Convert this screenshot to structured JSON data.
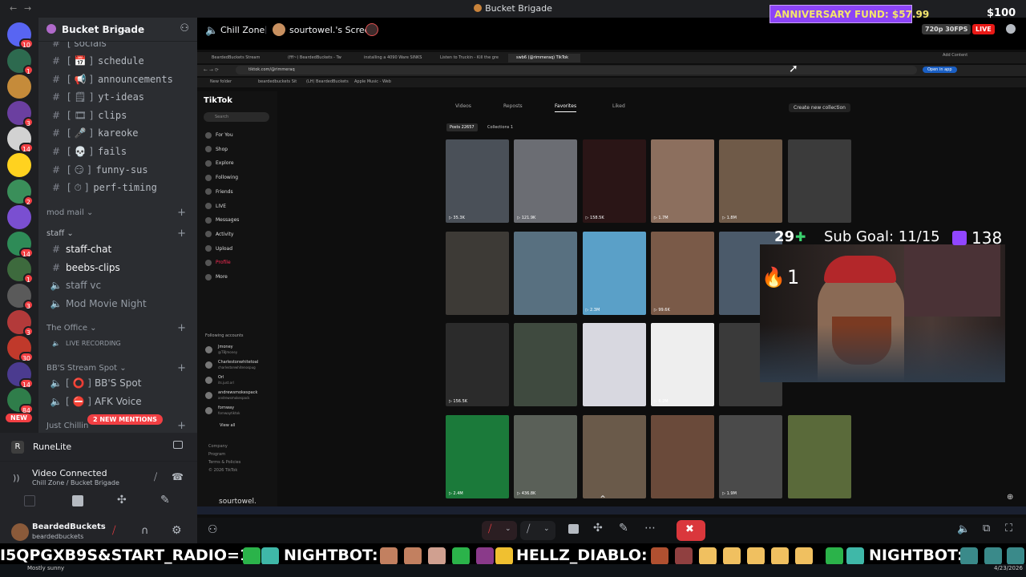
{
  "window": {
    "title": "Bucket Brigade",
    "back": "←",
    "forward": "→"
  },
  "server": {
    "name": "Bucket Brigade"
  },
  "rail_badges": [
    "10",
    "1",
    "",
    "3",
    "14",
    "",
    "2",
    "",
    "14",
    "1",
    "3",
    "3",
    "30",
    "14",
    "84"
  ],
  "rail_new": "NEW",
  "channels": {
    "top_partial": "socials",
    "items": [
      {
        "label": "schedule",
        "icon": "📅",
        "type": "text"
      },
      {
        "label": "announcements",
        "icon": "📢",
        "type": "text"
      },
      {
        "label": "yt-ideas",
        "icon": "🗒",
        "type": "text"
      },
      {
        "label": "clips",
        "icon": "🎞",
        "type": "text"
      },
      {
        "label": "kareoke",
        "icon": "🎤",
        "type": "text"
      },
      {
        "label": "fails",
        "icon": "💀",
        "type": "text"
      },
      {
        "label": "funny-sus",
        "icon": "😏",
        "type": "text"
      },
      {
        "label": "perf-timing",
        "icon": "⏱",
        "type": "text"
      }
    ],
    "cat_mod": "mod mail",
    "cat_staff": "staff",
    "staff_items": [
      {
        "label": "staff-chat",
        "type": "text"
      },
      {
        "label": "beebs-clips",
        "type": "text"
      },
      {
        "label": "staff vc",
        "type": "voice"
      },
      {
        "label": "Mod Movie Night",
        "type": "voice"
      }
    ],
    "cat_office": "The Office",
    "office_items": [
      {
        "label": "LIVE RECORDING",
        "type": "voice"
      }
    ],
    "cat_bbs": "BB'S Stream Spot",
    "bbs_items": [
      {
        "label": "BB'S Spot",
        "icon": "⭕",
        "type": "voice"
      },
      {
        "label": "AFK Voice",
        "icon": "⛔",
        "type": "voice"
      }
    ],
    "cat_chill": "Just Chillin",
    "mentions": "2 NEW MENTIONS"
  },
  "activity": {
    "name": "RuneLite"
  },
  "voice": {
    "status": "Video Connected",
    "location": "Chill Zone / Bucket Brigade"
  },
  "user": {
    "display": "BeardedBuckets",
    "username": "beardedbuckets"
  },
  "header": {
    "channel": "Chill Zone",
    "screen": "sourtowel.'s Screen"
  },
  "stream": {
    "fund": "ANNIVERSARY FUND: $57.99",
    "dollar": "$100",
    "quality": "720p 30FPS",
    "live": "LIVE",
    "sub_goal_count": "29",
    "sub_goal": "Sub Goal: 11/15",
    "subs": "138",
    "streak": "1"
  },
  "browser": {
    "tabs": [
      "BeardedBuckets Stream",
      "(fff~) BeardedBuckets - Tw",
      "installing a 4090 Ware SINKS",
      "Listen to Truckin - Kill the gre",
      "swb6 (@rimmeraq) TikTok"
    ],
    "address": "tiktok.com/@rimmeraq",
    "bookmarks": [
      "New folder",
      "beardedbuckets Sit",
      "(LH) BeardedBuckets",
      "Apple Music - Web"
    ],
    "add_content": "Add Content",
    "open_in_app": "Open in app"
  },
  "tiktok": {
    "logo": "TikTok",
    "search": "Search",
    "nav": [
      "For You",
      "Shop",
      "Explore",
      "Following",
      "Friends",
      "LIVE",
      "Messages",
      "Activity",
      "Upload",
      "Profile",
      "More"
    ],
    "following_title": "Following accounts",
    "following": [
      {
        "name": "Jmoney",
        "sub": "@TBJmoney"
      },
      {
        "name": "Charlestonwhitetoal",
        "sub": "charlestonwhitenospug"
      },
      {
        "name": "Orl",
        "sub": "its.just.orl"
      },
      {
        "name": "andrewsmokespack",
        "sub": "andrewsmokespack"
      },
      {
        "name": "fornway",
        "sub": "fornwaytiktok"
      }
    ],
    "view_all": "View all",
    "footer": [
      "Company",
      "Program",
      "Terms & Policies",
      "© 2026 TikTok"
    ],
    "tabs": [
      "Videos",
      "Reposts",
      "Favorites",
      "Liked"
    ],
    "create": "Create new collection",
    "posts_tab": "Posts 22657",
    "collections_tab": "Collections 1",
    "views": [
      "35.3K",
      "121.9K",
      "158.5K",
      "1.7M",
      "1.8M",
      "",
      "",
      "",
      "2.3M",
      "99.6K",
      "",
      "1.4M",
      "156.5K",
      "",
      "",
      "6.2M",
      "",
      "",
      "2.4M",
      "436.8K",
      "",
      "",
      "1.9M",
      ""
    ]
  },
  "footer_user": "sourtowel.",
  "ticker": {
    "segments": [
      "I5QPGXB9S&START_RADIO=1",
      "NIGHTBOT:",
      "HELLZ_DIABLO:",
      "NIGHTBOT:"
    ]
  },
  "taskbar": {
    "weather": "Mostly sunny",
    "date": "4/23/2026"
  },
  "colors": {
    "live": "#e91916",
    "fund_bg": "#8c44f7",
    "twitch": "#9146ff",
    "mention": "#f23f43"
  }
}
